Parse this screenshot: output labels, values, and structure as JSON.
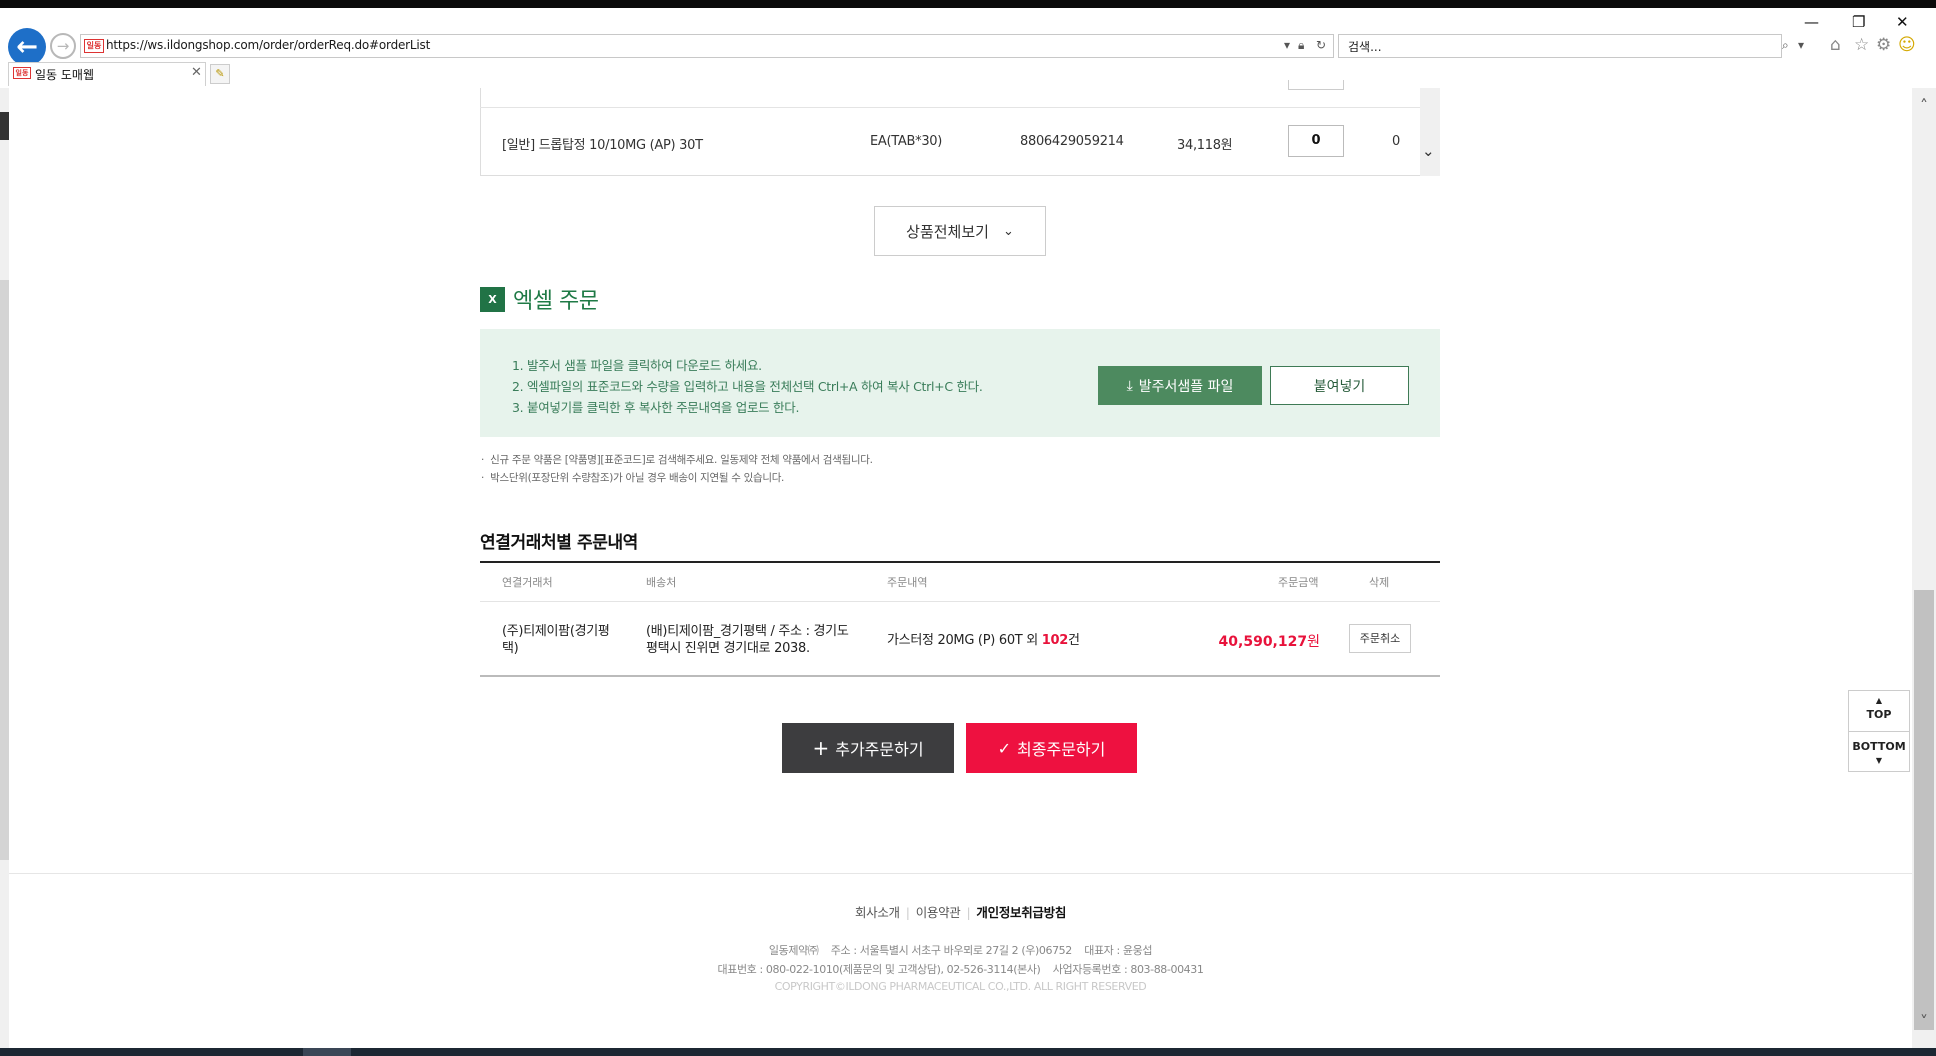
{
  "browser": {
    "url": "https://ws.ildongshop.com/order/orderReq.do#orderList",
    "search_placeholder": "검색...",
    "tab_title": "일동 도매웹",
    "favicon_text": "일동"
  },
  "product_row": {
    "name": "[일반] 드롭탑정 10/10MG (AP) 30T",
    "unit": "EA(TAB*30)",
    "code": "8806429059214",
    "price": "34,118원",
    "qty": "0",
    "total": "0"
  },
  "view_all_label": "상품전체보기",
  "excel": {
    "icon_text": "X",
    "title": "엑셀 주문",
    "steps": [
      "1. 발주서 샘플 파일을 클릭하여 다운로드 하세요.",
      "2. 엑셀파일의 표준코드와 수량을 입력하고 내용을 전체선택 Ctrl+A 하여 복사 Ctrl+C 한다.",
      "3. 붙여넣기를 클릭한 후 복사한 주문내역을 업로드 한다."
    ],
    "download_label": "발주서샘플 파일",
    "paste_label": "붙여넣기",
    "notes": [
      "신규 주문 약품은 [약품명][표준코드]로 검색해주세요. 일동제약 전체 약품에서 검색됩니다.",
      "박스단위(포장단위 수량참조)가 아닐 경우 배송이 지연될 수 있습니다."
    ]
  },
  "history": {
    "title": "연결거래처별 주문내역",
    "columns": [
      "연결거래처",
      "배송처",
      "주문내역",
      "주문금액",
      "삭제"
    ],
    "row": {
      "partner_line1": "(주)티제이팜(경기평",
      "partner_line2": "택)",
      "delivery_line1": "(배)티제이팜_경기평택 / 주소 : 경기도",
      "delivery_line2": "평택시 진위면 경기대로 2038.",
      "order_text": "가스터정 20MG (P) 60T 외",
      "order_count": "102",
      "order_suffix": "건",
      "amount": "40,590,127",
      "amount_unit": "원",
      "cancel_label": "주문취소"
    }
  },
  "actions": {
    "add_label": "추가주문하기",
    "final_label": "최종주문하기"
  },
  "floatnav": {
    "top": "TOP",
    "bottom": "BOTTOM"
  },
  "footer": {
    "links": [
      "회사소개",
      "이용약관",
      "개인정보취급방침"
    ],
    "line1": "일동제약㈜    주소 : 서울특별시 서초구 바우뫼로 27길 2 (우)06752    대표자 : 윤웅섭",
    "line2": "대표번호 : 080-022-1010(제품문의 및 고객상담), 02-526-3114(본사)    사업자등록번호 : 803-88-00431",
    "copyright": "COPYRIGHT©ILDONG PHARMACEUTICAL CO.,LTD. ALL RIGHT RESERVED"
  },
  "colors": {
    "accent_red": "#ee1140",
    "excel_green": "#217346",
    "excel_bg": "#e7f3ec",
    "dark_button": "#3d3d3f"
  }
}
